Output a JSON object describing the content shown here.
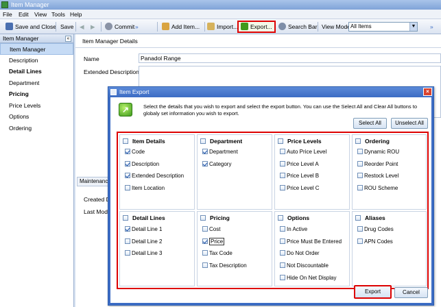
{
  "window": {
    "title": "Item Manager"
  },
  "menu": [
    "File",
    "Edit",
    "View",
    "Tools",
    "Help"
  ],
  "toolbar": {
    "save_close": "Save and Close",
    "save": "Save",
    "commit": "Commit",
    "add_item": "Add Item...",
    "import": "Import...",
    "export": "Export...",
    "search_bar": "Search Bar",
    "view_mode_label": "View Mode",
    "view_mode_value": "All Items"
  },
  "sidebar": {
    "header": "Item Manager",
    "items": [
      {
        "label": "Item Manager",
        "selected": true,
        "bold": false
      },
      {
        "label": "Description",
        "selected": false,
        "bold": false
      },
      {
        "label": "Detail Lines",
        "selected": false,
        "bold": true
      },
      {
        "label": "Department",
        "selected": false,
        "bold": false
      },
      {
        "label": "Pricing",
        "selected": false,
        "bold": true
      },
      {
        "label": "Price Levels",
        "selected": false,
        "bold": false
      },
      {
        "label": "Options",
        "selected": false,
        "bold": false
      },
      {
        "label": "Ordering",
        "selected": false,
        "bold": false
      }
    ]
  },
  "main": {
    "header": "Item Manager Details",
    "name_label": "Name",
    "name_value": "Panadol Range",
    "ext_desc_label": "Extended Description",
    "tab_label": "Maintenance",
    "created_label": "Created D",
    "last_modified_label": "Last Modif"
  },
  "dialog": {
    "title": "Item Export",
    "instructions": "Select the details that you wish to export and select the export button. You can use the Select All and Clear All buttons to globaly set information you wish to export.",
    "select_all": "Select All",
    "unselect_all": "Unselect All",
    "export": "Export",
    "cancel": "Cancel",
    "categories": [
      {
        "title": "Item Details",
        "options": [
          {
            "label": "Code",
            "checked": true
          },
          {
            "label": "Description",
            "checked": true
          },
          {
            "label": "Extended Description",
            "checked": true
          },
          {
            "label": "Item Location",
            "checked": false
          }
        ]
      },
      {
        "title": "Department",
        "options": [
          {
            "label": "Department",
            "checked": true
          },
          {
            "label": "Category",
            "checked": true
          }
        ]
      },
      {
        "title": "Price Levels",
        "options": [
          {
            "label": "Auto Price Level",
            "checked": false
          },
          {
            "label": "Price Level A",
            "checked": false
          },
          {
            "label": "Price Level B",
            "checked": false
          },
          {
            "label": "Price Level C",
            "checked": false
          }
        ]
      },
      {
        "title": "Ordering",
        "options": [
          {
            "label": "Dynamic ROU",
            "checked": false
          },
          {
            "label": "Reorder Point",
            "checked": false
          },
          {
            "label": "Restock Level",
            "checked": false
          },
          {
            "label": "ROU Scheme",
            "checked": false
          }
        ]
      },
      {
        "title": "Detail Lines",
        "options": [
          {
            "label": "Detail Line 1",
            "checked": true
          },
          {
            "label": "Detail Line 2",
            "checked": false
          },
          {
            "label": "Detail Line 3",
            "checked": false
          }
        ]
      },
      {
        "title": "Pricing",
        "options": [
          {
            "label": "Cost",
            "checked": false
          },
          {
            "label": "Price",
            "checked": true
          },
          {
            "label": "Tax Code",
            "checked": false
          },
          {
            "label": "Tax Description",
            "checked": false
          }
        ]
      },
      {
        "title": "Options",
        "options": [
          {
            "label": "In Active",
            "checked": false
          },
          {
            "label": "Price Must Be Entered",
            "checked": false
          },
          {
            "label": "Do Not Order",
            "checked": false
          },
          {
            "label": "Not Discountable",
            "checked": false
          },
          {
            "label": "Hide On Net Display",
            "checked": false
          }
        ]
      },
      {
        "title": "Aliases",
        "options": [
          {
            "label": "Drug Codes",
            "checked": false
          },
          {
            "label": "APN Codes",
            "checked": false
          }
        ]
      }
    ]
  },
  "colors": {
    "accent": "#3c6cc4",
    "highlight": "#dd0000",
    "selection": "#c6dbf5"
  }
}
